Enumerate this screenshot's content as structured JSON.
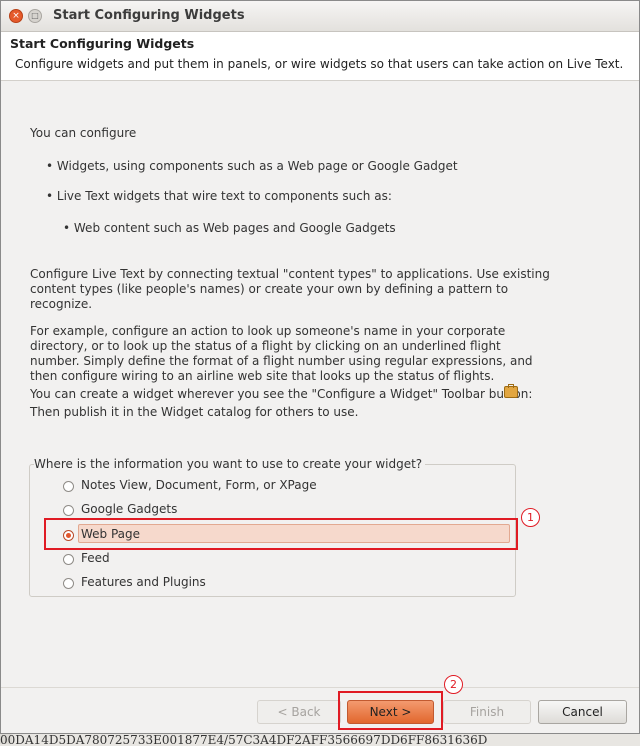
{
  "window": {
    "title": "Start Configuring Widgets",
    "close_glyph": "×",
    "maximize_glyph": "□"
  },
  "header": {
    "title": "Start Configuring Widgets",
    "description": "Configure widgets and put them in panels, or wire widgets so that users can take action on Live Text."
  },
  "body": {
    "intro": "You can configure",
    "bullet1": "• Widgets, using components such as a Web page or Google Gadget",
    "bullet2": "• Live Text widgets that wire text to components such as:",
    "subbullet": "• Web content such as Web pages and Google Gadgets",
    "para1_line1": "Configure Live Text by connecting textual \"content types\" to applications. Use existing",
    "para1_line2": "content types (like people's names) or create your own by defining a pattern to",
    "para1_line3": "recognize.",
    "para2_line1": "For example, configure an action to look up someone's name in your corporate",
    "para2_line2": "directory, or to look up the status of a flight by clicking on an underlined flight",
    "para2_line3": "number.  Simply define the format of a flight number using regular expressions, and",
    "para2_line4": "then configure wiring to an airline web site that looks up the status of flights.",
    "para3_line1": "You can create a widget wherever you see the \"Configure a Widget\" Toolbar button:",
    "para3_line2": "Then publish it in the Widget catalog for others to use.",
    "toolbar_icon": "briefcase-icon"
  },
  "source_group": {
    "label": "Where is the information you want to use to create your widget?",
    "options": [
      {
        "label": "Notes View, Document, Form, or XPage",
        "selected": false
      },
      {
        "label": "Google Gadgets",
        "selected": false
      },
      {
        "label": "Web Page",
        "selected": true
      },
      {
        "label": "Feed",
        "selected": false
      },
      {
        "label": "Features and Plugins",
        "selected": false
      }
    ]
  },
  "annotations": {
    "badge1": "1",
    "badge2": "2",
    "color": "#e01b24"
  },
  "buttons": {
    "back": "< Back",
    "next": "Next >",
    "finish": "Finish",
    "cancel": "Cancel"
  },
  "background": {
    "hash_text": "00DA14D5DA780725733E001877E4/57C3A4DF2AFF3566697DD6FF8631636D"
  },
  "colors": {
    "accent": "#e2672e",
    "selection": "#f6d9cc"
  }
}
